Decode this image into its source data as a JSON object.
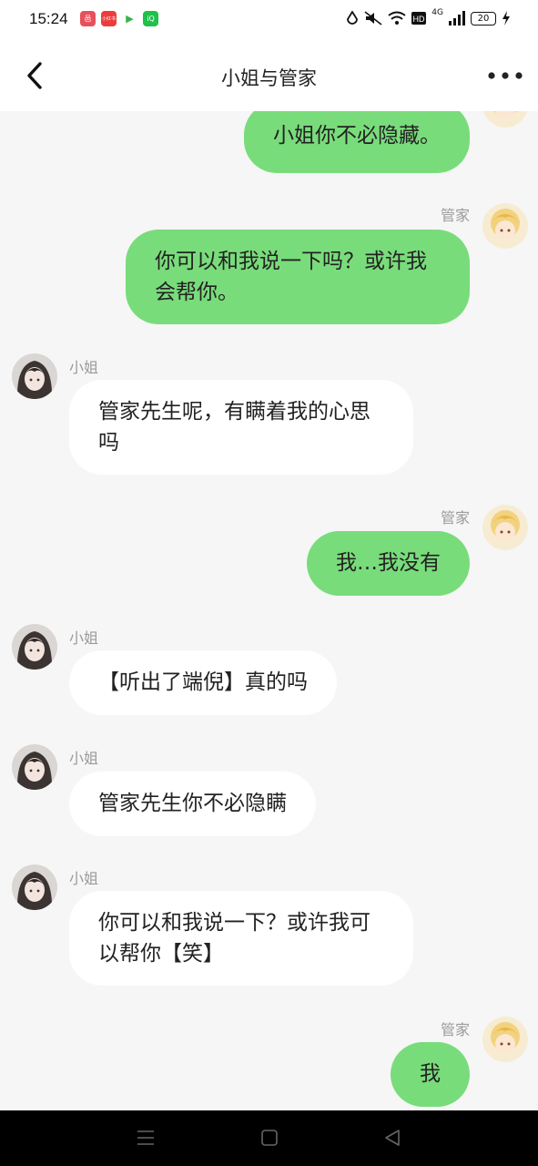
{
  "status_bar": {
    "time": "15:24",
    "apps": [
      {
        "name": "app-1",
        "color": "#e8505b",
        "label": "邑"
      },
      {
        "name": "app-2",
        "color": "#ee3b3b",
        "label": "小红书"
      },
      {
        "name": "app-3",
        "color": "#36b24a",
        "label": "▶"
      },
      {
        "name": "app-4",
        "color": "#20c04a",
        "label": "iQ"
      }
    ],
    "battery": "20",
    "signal_label": "4G"
  },
  "header": {
    "title": "小姐与管家"
  },
  "colors": {
    "right_bubble": "#79dc7b",
    "left_bubble": "#ffffff",
    "background": "#f6f6f6"
  },
  "messages": [
    {
      "side": "right",
      "sender": "",
      "text": "小姐你不必隐藏。"
    },
    {
      "side": "right",
      "sender": "管家",
      "text": "你可以和我说一下吗？或许我会帮你。"
    },
    {
      "side": "left",
      "sender": "小姐",
      "text": "管家先生呢，有瞒着我的心思吗"
    },
    {
      "side": "right",
      "sender": "管家",
      "text": "我…我没有"
    },
    {
      "side": "left",
      "sender": "小姐",
      "text": "【听出了端倪】真的吗"
    },
    {
      "side": "left",
      "sender": "小姐",
      "text": "管家先生你不必隐瞒"
    },
    {
      "side": "left",
      "sender": "小姐",
      "text": "你可以和我说一下？或许我可以帮你【笑】"
    },
    {
      "side": "right",
      "sender": "管家",
      "text": "我"
    }
  ]
}
